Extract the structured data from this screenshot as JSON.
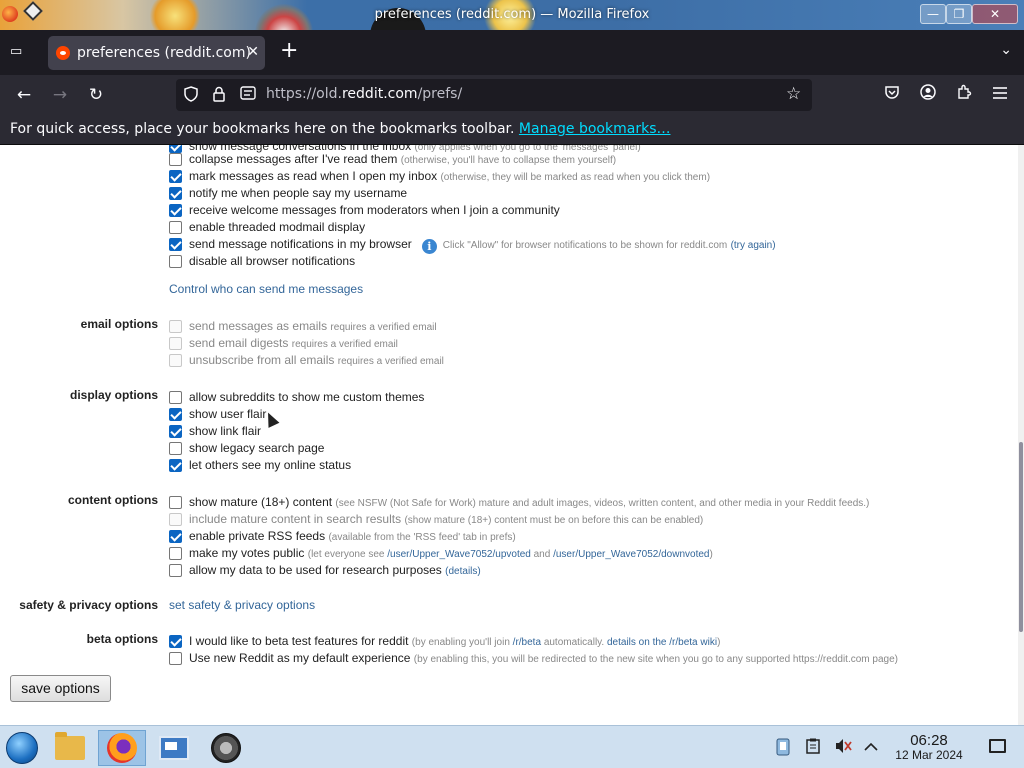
{
  "window": {
    "title": "preferences (reddit.com) — Mozilla Firefox",
    "controls": {
      "minimize": "—",
      "maximize": "❐",
      "close": "✕"
    }
  },
  "tabs": [
    {
      "label": "preferences (reddit.com)",
      "close": "✕"
    }
  ],
  "tabstrip": {
    "new_tab": "+",
    "list_all": "▭",
    "overflow": "⌄"
  },
  "nav": {
    "back": "←",
    "forward": "→",
    "reload": "↻",
    "url_prefix": "https://old.",
    "url_domain": "reddit.com",
    "url_path": "/prefs/",
    "bookmark_star": "☆"
  },
  "bookmarks_bar": {
    "message": "For quick access, place your bookmarks here on the bookmarks toolbar.",
    "link": "Manage bookmarks…"
  },
  "prefs": {
    "messaging_rows": [
      {
        "label": "show message conversations in the inbox",
        "hint": "(only applies when you go to the 'messages' panel)",
        "checked": true
      },
      {
        "label": "collapse messages after I've read them",
        "hint": "(otherwise, you'll have to collapse them yourself)",
        "checked": false
      },
      {
        "label": "mark messages as read when I open my inbox",
        "hint": "(otherwise, they will be marked as read when you click them)",
        "checked": true
      },
      {
        "label": "notify me when people say my username",
        "hint": "",
        "checked": true
      },
      {
        "label": "receive welcome messages from moderators when I join a community",
        "hint": "",
        "checked": true
      },
      {
        "label": "enable threaded modmail display",
        "hint": "",
        "checked": false
      },
      {
        "label": "send message notifications in my browser",
        "hint": "",
        "checked": true
      },
      {
        "label": "disable all browser notifications",
        "hint": "",
        "checked": false
      }
    ],
    "notification_info": {
      "icon": "i",
      "text": "Click \"Allow\" for browser notifications to be shown for reddit.com",
      "link": "(try again)"
    },
    "control_link": "Control who can send me messages",
    "email": {
      "title": "email options",
      "rows": [
        {
          "label": "send messages as emails",
          "hint": "requires a verified email",
          "checked": false
        },
        {
          "label": "send email digests",
          "hint": "requires a verified email",
          "checked": false
        },
        {
          "label": "unsubscribe from all emails",
          "hint": "requires a verified email",
          "checked": false
        }
      ]
    },
    "display": {
      "title": "display options",
      "rows": [
        {
          "label": "allow subreddits to show me custom themes",
          "checked": false
        },
        {
          "label": "show user flair",
          "checked": true
        },
        {
          "label": "show link flair",
          "checked": true
        },
        {
          "label": "show legacy search page",
          "checked": false
        },
        {
          "label": "let others see my online status",
          "checked": true
        }
      ]
    },
    "content": {
      "title": "content options",
      "rows": [
        {
          "label": "show mature (18+) content",
          "hint": "(see NSFW (Not Safe for Work) mature and adult images, videos, written content, and other media in your Reddit feeds.)",
          "checked": false,
          "disabled": false
        },
        {
          "label": "include mature content in search results",
          "hint": "(show mature (18+) content must be on before this can be enabled)",
          "checked": false,
          "disabled": true
        },
        {
          "label": "enable private RSS feeds",
          "hint": "(available from the 'RSS feed' tab in prefs)",
          "checked": true,
          "disabled": false
        },
        {
          "label": "make my votes public",
          "checked": false,
          "disabled": false
        },
        {
          "label": "allow my data to be used for research purposes",
          "checked": false,
          "disabled": false
        }
      ],
      "votes_hint_a": "(let everyone see",
      "votes_link_up": "/user/Upper_Wave7052/upvoted",
      "votes_hint_and": "and",
      "votes_link_down": "/user/Upper_Wave7052/downvoted",
      "votes_hint_close": ")",
      "research_details": "(details)"
    },
    "safety": {
      "title": "safety & privacy options",
      "link": "set safety & privacy options"
    },
    "beta": {
      "title": "beta options",
      "row1_label": "I would like to beta test features for reddit",
      "row1_hint_a": "(by enabling you'll join",
      "row1_link_sub": "/r/beta",
      "row1_hint_b": "automatically.",
      "row1_link_wiki": "details on the /r/beta wiki",
      "row1_hint_close": ")",
      "row1_checked": true,
      "row2_label": "Use new Reddit as my default experience",
      "row2_hint": "(by enabling this, you will be redirected to the new site when you go to any supported https://reddit.com page)",
      "row2_checked": false
    },
    "save_button": "save options"
  },
  "taskbar": {
    "clock_time": "06:28",
    "clock_date": "12 Mar 2024"
  }
}
